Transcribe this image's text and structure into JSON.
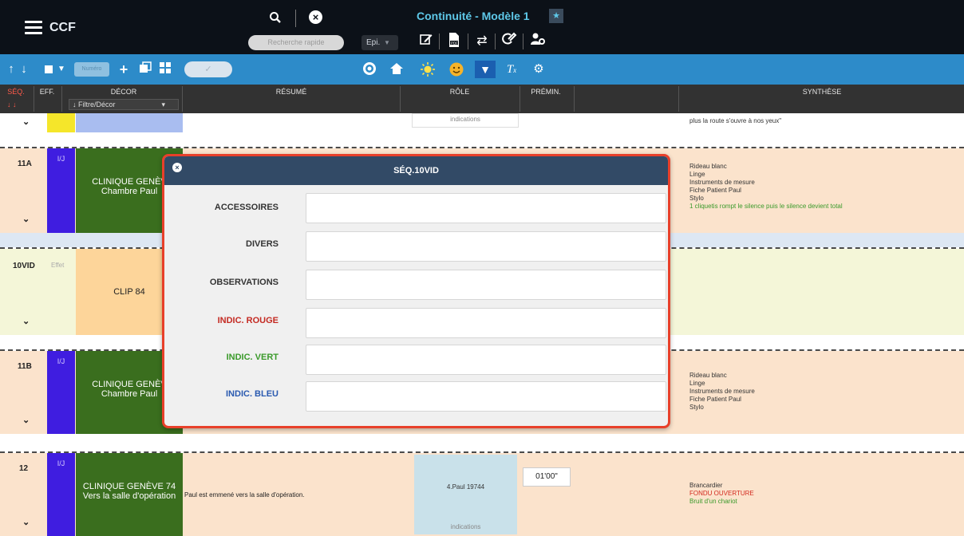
{
  "header": {
    "app_name": "CCF",
    "search_placeholder": "Recherche rapide",
    "episode_select": "Epi.",
    "title": "Continuité - Modèle 1",
    "star_icon": "star-icon"
  },
  "toolbar": {
    "num_placeholder": "Numéro",
    "pill_icon": "check-icon"
  },
  "columns": {
    "seq": "SÉQ.",
    "eff": "EFF.",
    "decor": "DÉCOR",
    "decor_filter": "Filtre/Décor",
    "resume": "RÉSUMÉ",
    "role": "RÔLE",
    "premin": "PRÉMIN.",
    "synthese": "SYNTHÈSE"
  },
  "top_row": {
    "indications": "indications",
    "synth_line1": "plus la route s'ouvre à nos yeux\""
  },
  "rows": [
    {
      "seq": "11A",
      "eff": "I/J",
      "decor_line1": "CLINIQUE GENÈV",
      "decor_line2": "Chambre Paul",
      "synthese": [
        "Rideau blanc",
        "Linge",
        "Instruments de mesure",
        "Fiche Patient Paul",
        "Stylo"
      ],
      "synthese_green": "1 cliquetis rompt le silence puis le silence devient total"
    },
    {
      "seq": "10VID",
      "eff": "Effet",
      "decor": "CLIP 84"
    },
    {
      "seq": "11B",
      "eff": "I/J",
      "decor_line1": "CLINIQUE GENÈV",
      "decor_line2": "Chambre Paul",
      "synthese": [
        "Rideau blanc",
        "Linge",
        "Instruments de mesure",
        "Fiche Patient Paul",
        "Stylo"
      ]
    },
    {
      "seq": "12",
      "eff": "I/J",
      "decor_line1": "CLINIQUE GENÈVE 74",
      "decor_line2": "Vers la salle d'opération",
      "resume": "Paul est emmené vers la salle d'opération.",
      "role": "4.Paul 19744",
      "role_indications": "indications",
      "premin": "01'00\"",
      "synthese": [
        "Brancardier"
      ],
      "synthese_red": "FONDU OUVERTURE",
      "synthese_green": "Bruit d'un chariot"
    }
  ],
  "modal": {
    "title": "SÉQ.10VID",
    "fields": [
      {
        "label": "ACCESSOIRES",
        "color": "#333333",
        "value": ""
      },
      {
        "label": "DIVERS",
        "color": "#333333",
        "value": ""
      },
      {
        "label": "OBSERVATIONS",
        "color": "#333333",
        "value": ""
      },
      {
        "label": "INDIC. ROUGE",
        "color": "#c42a22",
        "value": ""
      },
      {
        "label": "INDIC. VERT",
        "color": "#3a9a2a",
        "value": ""
      },
      {
        "label": "INDIC. BLEU",
        "color": "#2a5ab0",
        "value": ""
      }
    ]
  }
}
